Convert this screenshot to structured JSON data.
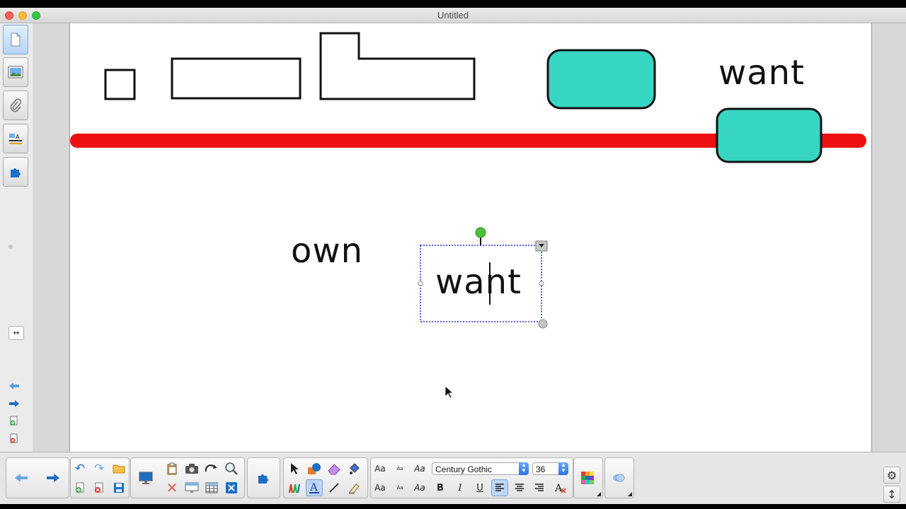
{
  "window": {
    "title": "Untitled"
  },
  "canvas": {
    "words": [
      {
        "id": "want-top",
        "text": "want"
      },
      {
        "id": "own",
        "text": "own"
      },
      {
        "id": "want-selected",
        "text": "want"
      }
    ]
  },
  "toolbar": {
    "font_family": "Century Gothic",
    "font_size": "36",
    "text_samples": {
      "aa_large": "Aa",
      "aa_small": "Aa",
      "aa_italic": "Aa"
    },
    "bold_label": "B",
    "italic_label": "I",
    "underline_label": "U"
  },
  "colors": {
    "red_bar": "#ee1111",
    "teal_box": "#36d6c2",
    "selection_border": "#1a2fd0",
    "pin_green": "#4cbf3a"
  },
  "icons": [
    "page-sorter-icon",
    "gallery-icon",
    "attachments-icon",
    "properties-icon",
    "addons-icon",
    "undo-icon",
    "redo-icon",
    "open-icon",
    "save-icon",
    "select-icon",
    "pen-icon",
    "text-icon",
    "eraser-icon"
  ]
}
